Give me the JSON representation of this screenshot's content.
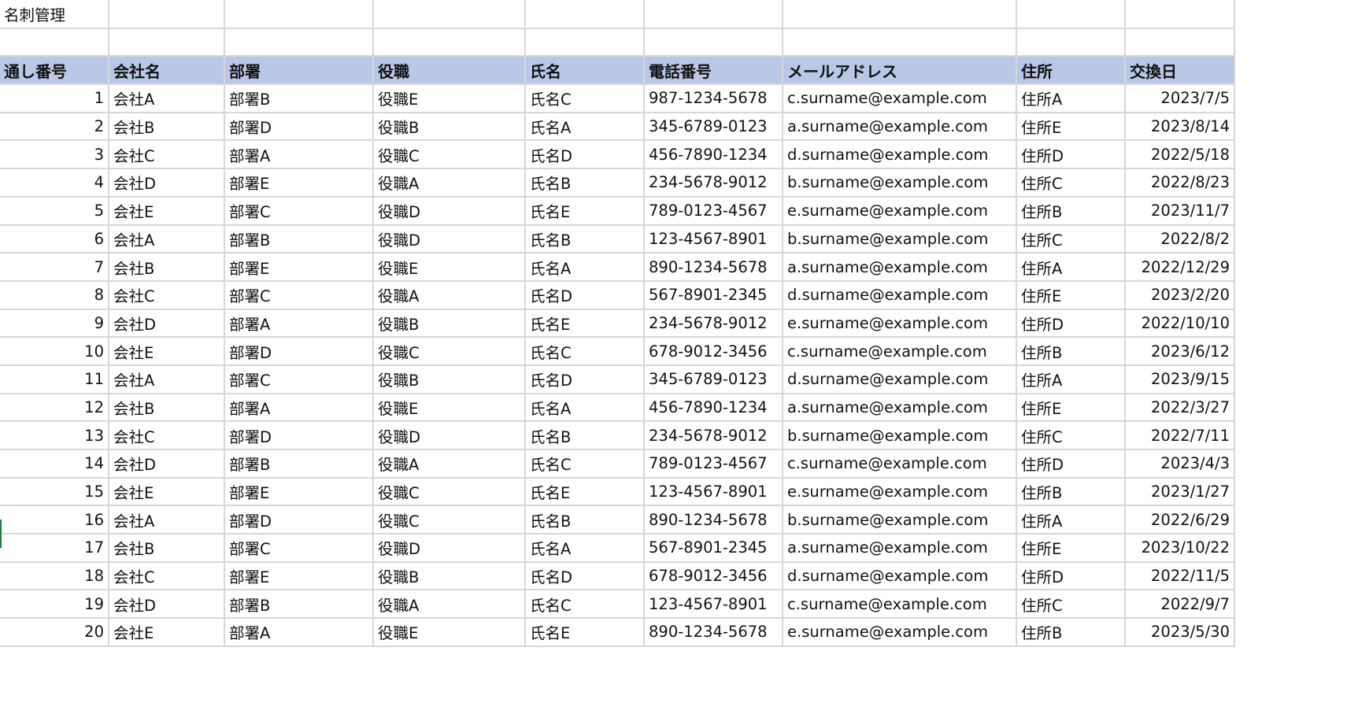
{
  "sheet_title": "名刺管理",
  "columns": [
    "通し番号",
    "会社名",
    "部署",
    "役職",
    "氏名",
    "電話番号",
    "メールアドレス",
    "住所",
    "交換日"
  ],
  "rows": [
    [
      "1",
      "会社A",
      "部署B",
      "役職E",
      "氏名C",
      "987-1234-5678",
      "c.surname@example.com",
      "住所A",
      "2023/7/5"
    ],
    [
      "2",
      "会社B",
      "部署D",
      "役職B",
      "氏名A",
      "345-6789-0123",
      "a.surname@example.com",
      "住所E",
      "2023/8/14"
    ],
    [
      "3",
      "会社C",
      "部署A",
      "役職C",
      "氏名D",
      "456-7890-1234",
      "d.surname@example.com",
      "住所D",
      "2022/5/18"
    ],
    [
      "4",
      "会社D",
      "部署E",
      "役職A",
      "氏名B",
      "234-5678-9012",
      "b.surname@example.com",
      "住所C",
      "2022/8/23"
    ],
    [
      "5",
      "会社E",
      "部署C",
      "役職D",
      "氏名E",
      "789-0123-4567",
      "e.surname@example.com",
      "住所B",
      "2023/11/7"
    ],
    [
      "6",
      "会社A",
      "部署B",
      "役職D",
      "氏名B",
      "123-4567-8901",
      "b.surname@example.com",
      "住所C",
      "2022/8/2"
    ],
    [
      "7",
      "会社B",
      "部署E",
      "役職E",
      "氏名A",
      "890-1234-5678",
      "a.surname@example.com",
      "住所A",
      "2022/12/29"
    ],
    [
      "8",
      "会社C",
      "部署C",
      "役職A",
      "氏名D",
      "567-8901-2345",
      "d.surname@example.com",
      "住所E",
      "2023/2/20"
    ],
    [
      "9",
      "会社D",
      "部署A",
      "役職B",
      "氏名E",
      "234-5678-9012",
      "e.surname@example.com",
      "住所D",
      "2022/10/10"
    ],
    [
      "10",
      "会社E",
      "部署D",
      "役職C",
      "氏名C",
      "678-9012-3456",
      "c.surname@example.com",
      "住所B",
      "2023/6/12"
    ],
    [
      "11",
      "会社A",
      "部署C",
      "役職B",
      "氏名D",
      "345-6789-0123",
      "d.surname@example.com",
      "住所A",
      "2023/9/15"
    ],
    [
      "12",
      "会社B",
      "部署A",
      "役職E",
      "氏名A",
      "456-7890-1234",
      "a.surname@example.com",
      "住所E",
      "2022/3/27"
    ],
    [
      "13",
      "会社C",
      "部署D",
      "役職D",
      "氏名B",
      "234-5678-9012",
      "b.surname@example.com",
      "住所C",
      "2022/7/11"
    ],
    [
      "14",
      "会社D",
      "部署B",
      "役職A",
      "氏名C",
      "789-0123-4567",
      "c.surname@example.com",
      "住所D",
      "2023/4/3"
    ],
    [
      "15",
      "会社E",
      "部署E",
      "役職C",
      "氏名E",
      "123-4567-8901",
      "e.surname@example.com",
      "住所B",
      "2023/1/27"
    ],
    [
      "16",
      "会社A",
      "部署D",
      "役職C",
      "氏名B",
      "890-1234-5678",
      "b.surname@example.com",
      "住所A",
      "2022/6/29"
    ],
    [
      "17",
      "会社B",
      "部署C",
      "役職D",
      "氏名A",
      "567-8901-2345",
      "a.surname@example.com",
      "住所E",
      "2023/10/22"
    ],
    [
      "18",
      "会社C",
      "部署E",
      "役職B",
      "氏名D",
      "678-9012-3456",
      "d.surname@example.com",
      "住所D",
      "2022/11/5"
    ],
    [
      "19",
      "会社D",
      "部署B",
      "役職A",
      "氏名C",
      "123-4567-8901",
      "c.surname@example.com",
      "住所C",
      "2022/9/7"
    ],
    [
      "20",
      "会社E",
      "部署A",
      "役職E",
      "氏名E",
      "890-1234-5678",
      "e.surname@example.com",
      "住所B",
      "2023/5/30"
    ]
  ],
  "colors": {
    "header_fill": "#b8c8e6",
    "grid_line": "#d7d7d7",
    "active_marker": "#1e7b45"
  }
}
